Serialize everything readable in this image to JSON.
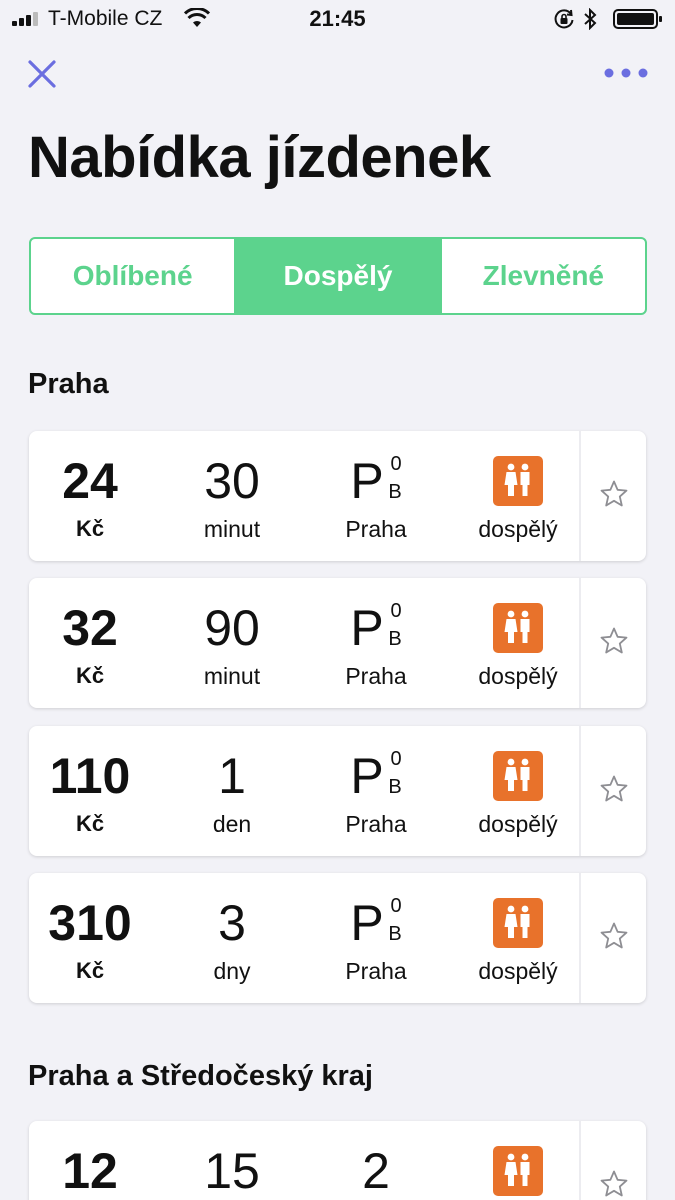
{
  "status_bar": {
    "carrier": "T-Mobile CZ",
    "time": "21:45"
  },
  "page": {
    "title": "Nabídka jízdenek"
  },
  "tabs": [
    {
      "label": "Oblíbené",
      "active": false
    },
    {
      "label": "Dospělý",
      "active": true
    },
    {
      "label": "Zlevněné",
      "active": false
    }
  ],
  "sections": [
    {
      "title": "Praha",
      "tickets": [
        {
          "price": "24",
          "currency": "Kč",
          "duration": "30",
          "unit": "minut",
          "zone": "P",
          "zone_sup": "0",
          "zone_sub": "B",
          "zone_label": "Praha",
          "rider": "dospělý"
        },
        {
          "price": "32",
          "currency": "Kč",
          "duration": "90",
          "unit": "minut",
          "zone": "P",
          "zone_sup": "0",
          "zone_sub": "B",
          "zone_label": "Praha",
          "rider": "dospělý"
        },
        {
          "price": "110",
          "currency": "Kč",
          "duration": "1",
          "unit": "den",
          "zone": "P",
          "zone_sup": "0",
          "zone_sub": "B",
          "zone_label": "Praha",
          "rider": "dospělý"
        },
        {
          "price": "310",
          "currency": "Kč",
          "duration": "3",
          "unit": "dny",
          "zone": "P",
          "zone_sup": "0",
          "zone_sub": "B",
          "zone_label": "Praha",
          "rider": "dospělý"
        }
      ]
    },
    {
      "title": "Praha a Středočeský kraj",
      "tickets": [
        {
          "price": "12",
          "duration": "15",
          "zone": "2"
        }
      ]
    }
  ],
  "colors": {
    "accent_green": "#5cd38d",
    "nav_purple": "#6b6ee0",
    "badge_orange": "#e8722b"
  }
}
